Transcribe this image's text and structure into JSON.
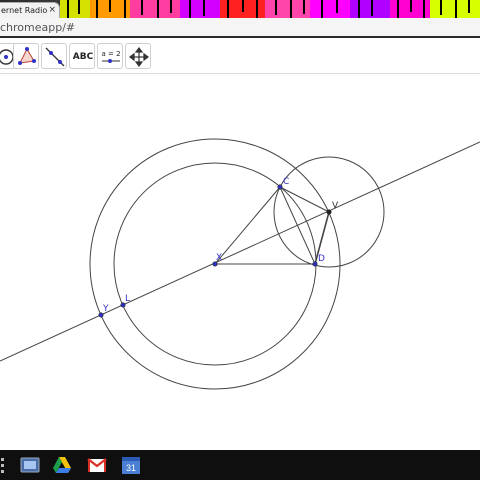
{
  "browser": {
    "tab_title": "ernet Radio",
    "tab_close_glyph": "×",
    "url": "chromeapp/#"
  },
  "toolbar": {
    "tools": [
      {
        "name": "move-graphics-tool",
        "icon": "circle-point-icon"
      },
      {
        "name": "polygon-tool",
        "icon": "triangle-icon"
      },
      {
        "name": "line-tool",
        "icon": "line-icon"
      },
      {
        "name": "text-tool",
        "label": "ABC"
      },
      {
        "name": "slider-tool",
        "label": "a = 2"
      },
      {
        "name": "move-view-tool",
        "icon": "move-arrows-icon"
      }
    ]
  },
  "geometry": {
    "points": [
      {
        "id": "C",
        "label": "C"
      },
      {
        "id": "V",
        "label": "V"
      },
      {
        "id": "X",
        "label": "X"
      },
      {
        "id": "D",
        "label": "D"
      },
      {
        "id": "Y",
        "label": "Y"
      },
      {
        "id": "L",
        "label": "L"
      }
    ],
    "point_color": "#3030c8",
    "line_color": "#333333"
  },
  "taskbar": {
    "apps": [
      "windows-icon",
      "drive-icon",
      "gmail-icon",
      "calendar-icon"
    ],
    "calendar_day": "31"
  }
}
